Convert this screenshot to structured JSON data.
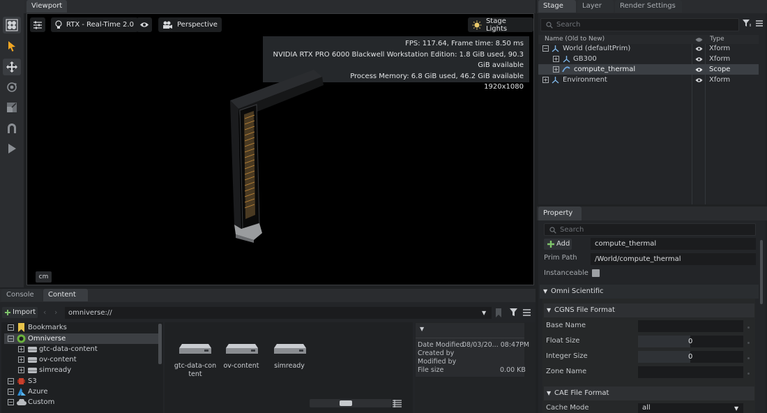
{
  "viewport": {
    "tab_label": "Viewport",
    "renderer_label": "RTX - Real-Time 2.0",
    "camera_label": "Perspective",
    "lights_label": "Stage Lights",
    "stats": {
      "fps_line": "FPS: 117.64, Frame time: 8.50 ms",
      "gpu_line": "NVIDIA RTX PRO 6000 Blackwell Workstation Edition: 1.8 GiB used, 90.3 GiB available",
      "process_line": "Process Memory: 6.8 GiB used, 46.2 GiB available",
      "resolution_line": "1920x1080"
    },
    "unit_label": "cm"
  },
  "stage": {
    "tabs": [
      "Stage",
      "Layer",
      "Render Settings"
    ],
    "search_placeholder": "Search",
    "columns": {
      "name": "Name (Old to New)",
      "type": "Type"
    },
    "rows": [
      {
        "name": "World (defaultPrim)",
        "type": "Xform"
      },
      {
        "name": "GB300",
        "type": "Xform"
      },
      {
        "name": "compute_thermal",
        "type": "Scope"
      },
      {
        "name": "Environment",
        "type": "Xform"
      }
    ]
  },
  "property": {
    "tab_label": "Property",
    "search_placeholder": "Search",
    "add_label": "Add",
    "prim_name": "compute_thermal",
    "prim_path_label": "Prim Path",
    "prim_path": "/World/compute_thermal",
    "instanceable_label": "Instanceable",
    "omni_scientific": "Omni Scientific",
    "cgns_section": "CGNS File Format",
    "base_name_label": "Base Name",
    "float_size_label": "Float Size",
    "float_size_value": "0",
    "integer_size_label": "Integer Size",
    "integer_size_value": "0",
    "zone_name_label": "Zone Name",
    "cae_section": "CAE File Format",
    "cache_mode_label": "Cache Mode",
    "cache_mode_value": "all"
  },
  "content": {
    "tabs": [
      "Console",
      "Content"
    ],
    "import_label": "Import",
    "path": "omniverse://",
    "tree": [
      {
        "label": "Bookmarks"
      },
      {
        "label": "Omniverse"
      },
      {
        "label": "gtc-data-content"
      },
      {
        "label": "ov-content"
      },
      {
        "label": "simready"
      },
      {
        "label": "S3"
      },
      {
        "label": "Azure"
      },
      {
        "label": "Custom"
      }
    ],
    "files": [
      {
        "label": "gtc-data-con\ntent"
      },
      {
        "label": "ov-content"
      },
      {
        "label": "simready"
      }
    ],
    "details": {
      "date_modified_label": "Date Modified",
      "date_modified_value": "08/03/20... 08:47PM",
      "created_by_label": "Created by",
      "modified_by_label": "Modified by",
      "file_size_label": "File size",
      "file_size_value": "0.00 KB"
    }
  }
}
